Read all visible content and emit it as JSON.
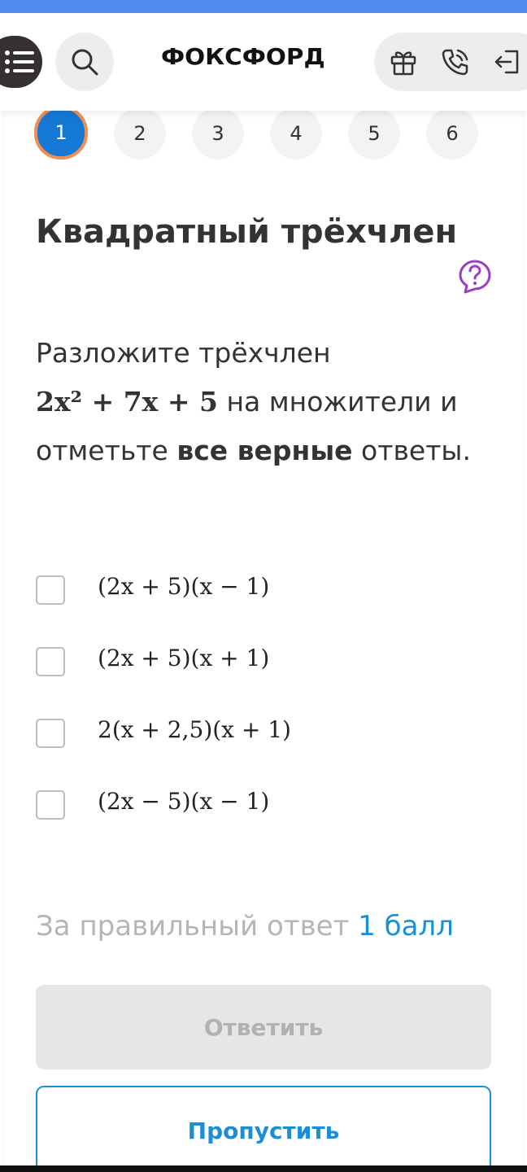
{
  "header": {
    "logo": "ФОКСФОРД",
    "icons": [
      "menu-icon",
      "search-icon",
      "gift-icon",
      "phone-icon",
      "logout-icon"
    ]
  },
  "steps": [
    {
      "label": "1",
      "active": true
    },
    {
      "label": "2",
      "active": false
    },
    {
      "label": "3",
      "active": false
    },
    {
      "label": "4",
      "active": false
    },
    {
      "label": "5",
      "active": false
    },
    {
      "label": "6",
      "active": false
    }
  ],
  "task": {
    "title": "Квадратный трёхчлен",
    "text_intro": "Разложите трёхчлен",
    "expression": "2x² + 7x + 5",
    "text_mid": " на множители и отметьте ",
    "text_bold": "все верные",
    "text_end": " ответы."
  },
  "options": [
    {
      "label": "(2x + 5)(x − 1)",
      "checked": false
    },
    {
      "label": "(2x + 5)(x + 1)",
      "checked": false
    },
    {
      "label": "2(x + 2,5)(x + 1)",
      "checked": false
    },
    {
      "label": "(2x − 5)(x − 1)",
      "checked": false
    }
  ],
  "score": {
    "prefix": "За правильный ответ",
    "value": "1 балл"
  },
  "buttons": {
    "answer": "Ответить",
    "skip": "Пропустить"
  },
  "colors": {
    "accent": "#1a8fd6",
    "active_step": "#1478d4",
    "active_step_ring": "#ef8f55",
    "help_icon": "#9a3fbf",
    "top_strip": "#4f8bf0"
  }
}
